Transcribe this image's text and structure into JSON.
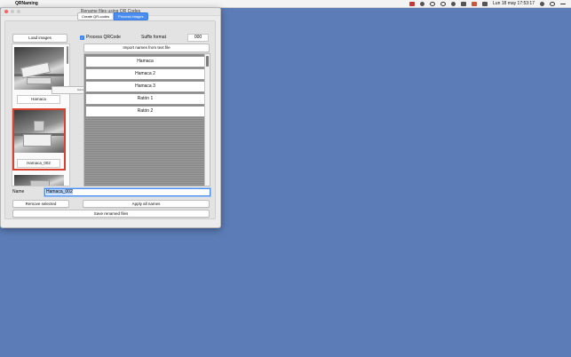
{
  "menubar": {
    "app_name": "QRNaming",
    "clock": "Lun 18 may  17:53:17"
  },
  "window": {
    "title": "Rename files using QR Codes",
    "tabs": [
      {
        "label": "Create QR-codes",
        "active": false
      },
      {
        "label": "Process images",
        "active": true
      }
    ]
  },
  "buttons": {
    "load_images": "Load images",
    "import_names": "Import names from text file",
    "remove_selected": "Remove selected",
    "apply_all": "Apply all names",
    "save_renamed": "Save renamed files"
  },
  "process_qr": {
    "label": "Process QRCode",
    "checked": true
  },
  "suffix": {
    "label": "Suffix format",
    "value": "000"
  },
  "images": [
    {
      "caption": "Hamaca",
      "selected": false
    },
    {
      "caption": "Hamaca_002",
      "selected": true
    },
    {
      "caption": "",
      "selected": false
    }
  ],
  "drag_tooltip": "Hamaca 3",
  "names_list": [
    "Hamaca",
    "Hamaca 2",
    "Hamaca 3",
    "Ratón 1",
    "Ratón 2"
  ],
  "name_field": {
    "label": "Name",
    "value": "Hamaca_002"
  },
  "colors": {
    "accent": "#4a8ff0",
    "selection": "#d9412f",
    "desktop": "#5b7cb6"
  }
}
